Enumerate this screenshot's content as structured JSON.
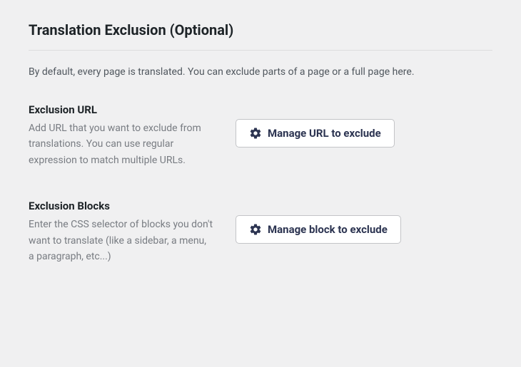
{
  "section": {
    "title": "Translation Exclusion (Optional)",
    "description": "By default, every page is translated. You can exclude parts of a page or a full page here."
  },
  "options": {
    "url": {
      "label": "Exclusion URL",
      "description": "Add URL that you want to exclude from translations. You can use regular expression to match multiple URLs.",
      "button": "Manage URL to exclude"
    },
    "blocks": {
      "label": "Exclusion Blocks",
      "description": "Enter the CSS selector of blocks you don't want to translate (like a sidebar, a menu, a paragraph, etc...)",
      "button": "Manage block to exclude"
    }
  },
  "icons": {
    "gear": "gear-icon"
  }
}
